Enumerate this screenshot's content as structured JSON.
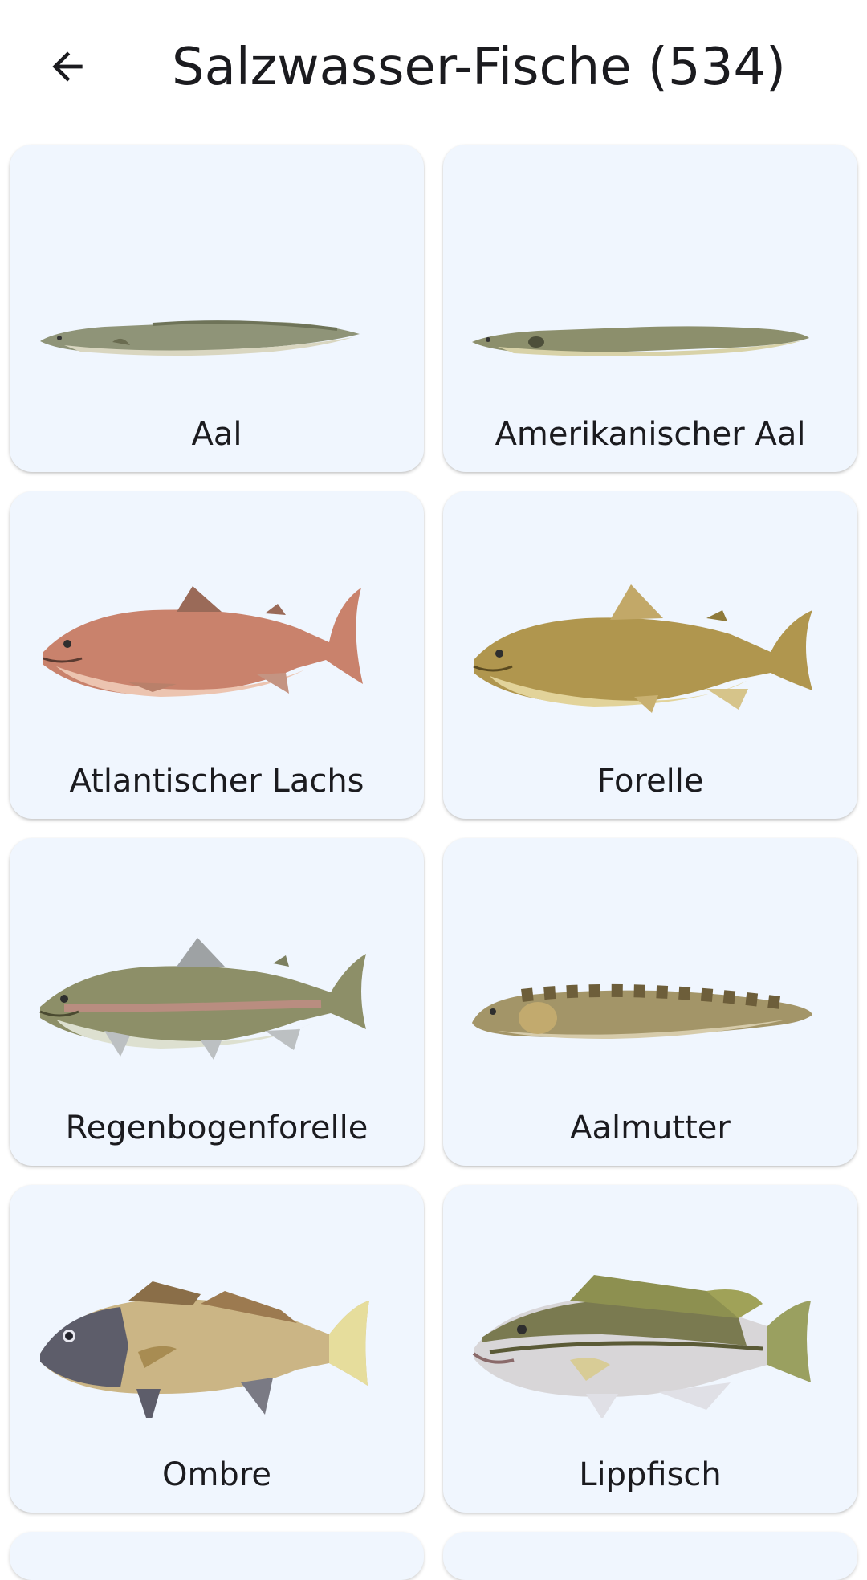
{
  "header": {
    "title": "Salzwasser-Fische (534)",
    "back_icon": "arrow-left-icon"
  },
  "fish": [
    {
      "name": "Aal"
    },
    {
      "name": "Amerikanischer Aal"
    },
    {
      "name": "Atlantischer Lachs"
    },
    {
      "name": "Forelle"
    },
    {
      "name": "Regenbogenforelle"
    },
    {
      "name": "Aalmutter"
    },
    {
      "name": "Ombre"
    },
    {
      "name": "Lippfisch"
    }
  ],
  "colors": {
    "card_background": "#f0f6fe",
    "text": "#1b1b1f"
  }
}
